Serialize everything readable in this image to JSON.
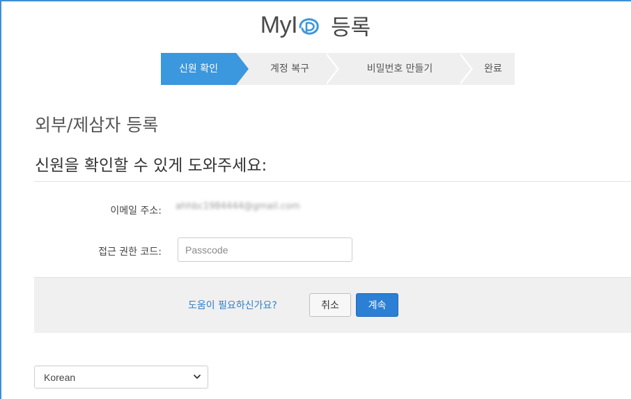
{
  "header": {
    "logo_text": "MyI",
    "title": "등록"
  },
  "steps": [
    {
      "label": "신원 확인",
      "active": true
    },
    {
      "label": "계정 복구",
      "active": false
    },
    {
      "label": "비밀번호 만들기",
      "active": false
    },
    {
      "label": "완료",
      "active": false
    }
  ],
  "main": {
    "heading": "외부/제삼자 등록",
    "subheading": "신원을 확인할 수 있게 도와주세요:",
    "email_label": "이메일 주소:",
    "email_value": "ahhbc1984444@gmail.com",
    "passcode_label": "접근 권한 코드:",
    "passcode_placeholder": "Passcode",
    "passcode_value": ""
  },
  "actions": {
    "help_link": "도움이 필요하신가요?",
    "cancel_label": "취소",
    "continue_label": "계속"
  },
  "language": {
    "selected": "Korean"
  },
  "colors": {
    "accent": "#3b97de",
    "primary_button": "#2b7fd4",
    "link": "#2f7fc8",
    "frame_border": "#3d8fd6"
  }
}
